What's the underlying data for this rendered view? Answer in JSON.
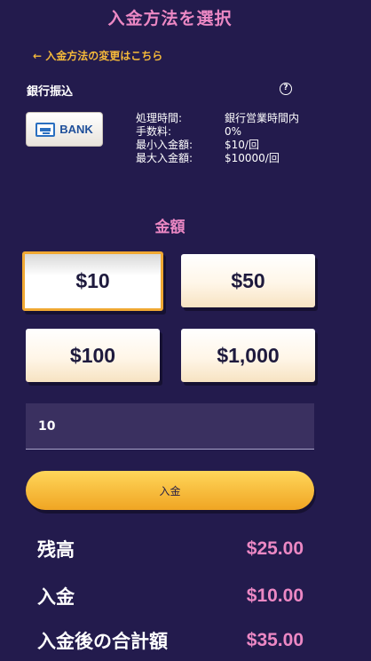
{
  "header": {
    "title": "入金方法を選択"
  },
  "back_link": "← 入金方法の変更はこちら",
  "method": {
    "name": "銀行振込",
    "logo_text": "BANK",
    "help_icon": "?",
    "info": [
      {
        "key": "処理時間:",
        "value": "銀行営業時間内"
      },
      {
        "key": "手数料:",
        "value": "0%"
      },
      {
        "key": "最小入金額:",
        "value": "$10/回"
      },
      {
        "key": "最大入金額:",
        "value": "$10000/回"
      }
    ]
  },
  "amount_section": {
    "title": "金額",
    "options": [
      "$10",
      "$50",
      "$100",
      "$1,000"
    ],
    "selected": "$10"
  },
  "input": {
    "value": "10"
  },
  "deposit_button": "入金",
  "summary": [
    {
      "label": "残高",
      "value": "$25.00"
    },
    {
      "label": "入金",
      "value": "$10.00"
    },
    {
      "label": "入金後の合計額",
      "value": "$35.00"
    }
  ],
  "colors": {
    "background": "#231b4d",
    "accent_pink": "#ec88c4",
    "accent_gold": "#f5b93a"
  }
}
